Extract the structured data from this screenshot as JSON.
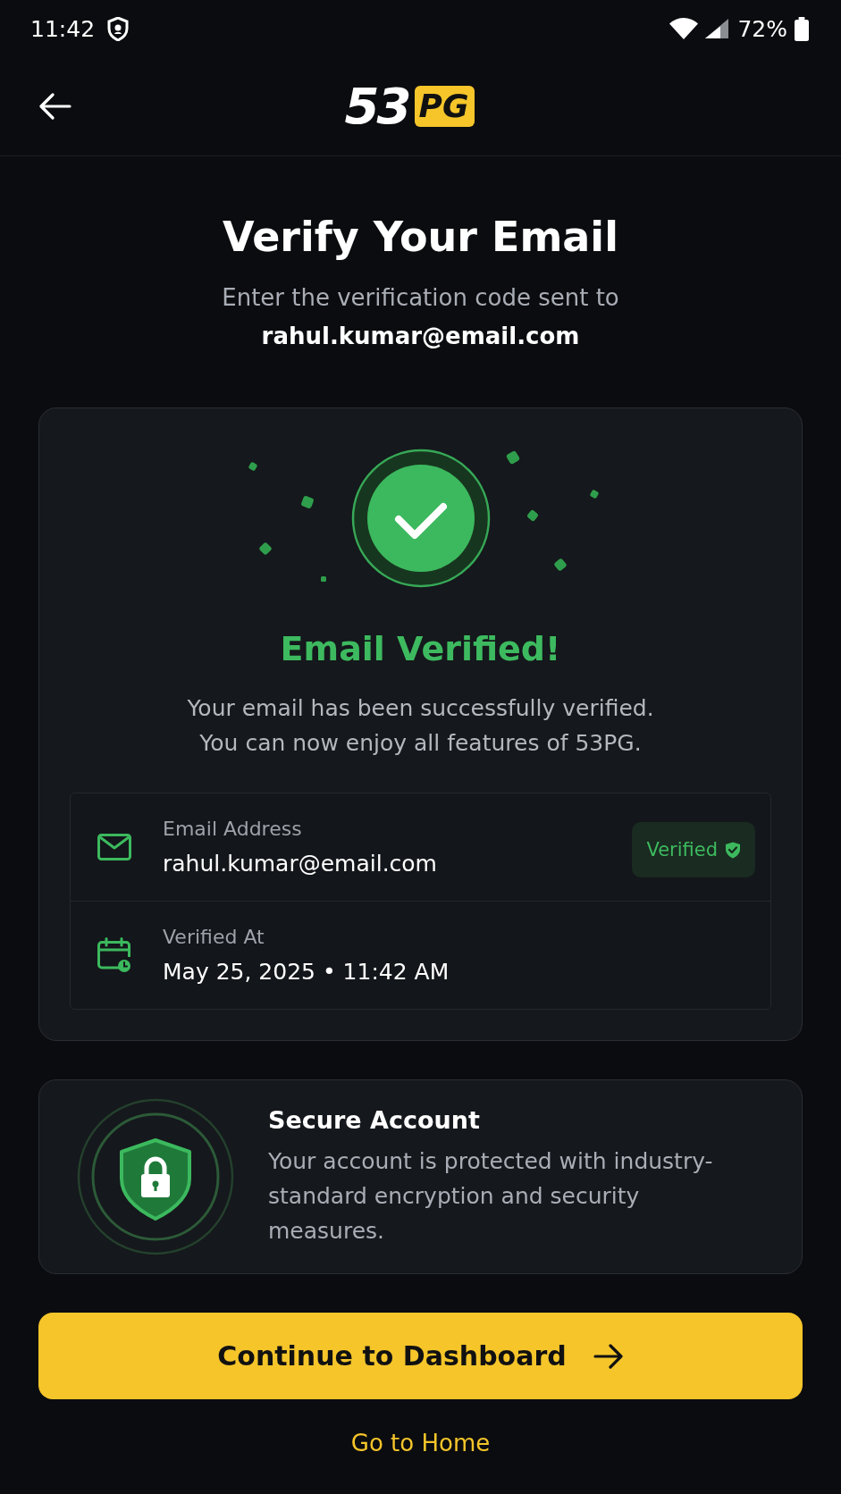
{
  "status_bar": {
    "time": "11:42",
    "battery": "72%"
  },
  "header": {
    "logo": {
      "wordmark": "53",
      "badge": "PG"
    }
  },
  "title": "Verify Your Email",
  "subtitle": "Enter the verification code sent to",
  "email": "rahul.kumar@email.com",
  "success": {
    "title": "Email Verified!",
    "messages": [
      "Your email has been successfully verified.",
      "You can now enjoy all features of 53PG."
    ]
  },
  "details": [
    {
      "kind": "email",
      "label": "Email Address",
      "value": "rahul.kumar@email.com",
      "badge": "Verified"
    },
    {
      "kind": "date",
      "label": "Verified At",
      "value": "May 25, 2025 • 11:42 AM"
    }
  ],
  "security": {
    "title": "Secure Account",
    "description": "Your account is protected with industry-standard encryption and security measures."
  },
  "primary_button": {
    "label": "Continue to Dashboard"
  },
  "secondary_link": {
    "label": "Go to Home"
  }
}
